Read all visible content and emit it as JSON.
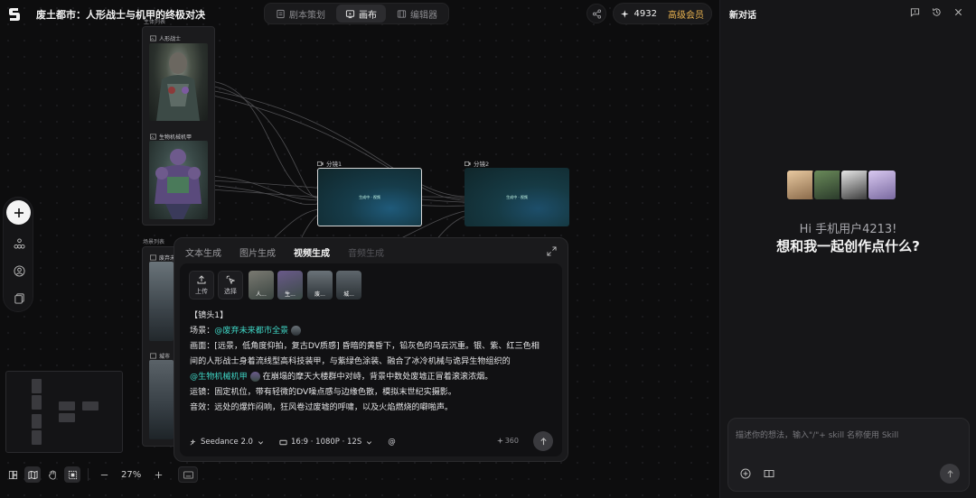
{
  "header": {
    "project_title": "废土都市：人形战士与机甲的终极对决",
    "tabs": [
      {
        "label": "剧本策划",
        "icon": "script-icon",
        "active": false
      },
      {
        "label": "画布",
        "icon": "canvas-icon",
        "active": true
      },
      {
        "label": "编辑器",
        "icon": "editor-icon",
        "active": false
      }
    ],
    "credits": "4932",
    "membership": "高级会员"
  },
  "canvas": {
    "character_group": {
      "title": "主体列表",
      "nodes": [
        {
          "label": "人形战士"
        },
        {
          "label": "生物机械机甲"
        }
      ]
    },
    "scene_group": {
      "title": "场景列表",
      "nodes": [
        {
          "label": "废弃未"
        },
        {
          "label": "城市"
        }
      ]
    },
    "shots": [
      {
        "label": "分镜1",
        "inner_text": "生成中 · 视频"
      },
      {
        "label": "分镜2",
        "inner_text": "生成中 · 视频"
      }
    ],
    "zoom": "27%"
  },
  "generator": {
    "tabs": [
      {
        "label": "文本生成",
        "state": "normal"
      },
      {
        "label": "图片生成",
        "state": "normal"
      },
      {
        "label": "视频生成",
        "state": "active"
      },
      {
        "label": "音频生成",
        "state": "disabled"
      }
    ],
    "upload_label": "上传",
    "select_label": "选择",
    "refs": [
      "人...",
      "生...",
      "废...",
      "城..."
    ],
    "prompt": {
      "heading": "【镜头1】",
      "scene_prefix": "场景：",
      "scene_mention": "@废弃未来都市全景",
      "frame_line1": "画面：[远景，低角度仰拍，复古DV质感] 昏暗的黄昏下，铅灰色的乌云沉重。银、紫、红三色相",
      "frame_line2": "间的人形战士身着流线型高科技装甲，与紫绿色涂装、融合了冰冷机械与诡异生物组织的",
      "mech_mention": "@生物机械机甲",
      "frame_line3": "在崩塌的摩天大楼群中对峙，背景中数处废墟正冒着滚滚浓烟。",
      "camera_line": "运镜：固定机位，带有轻微的DV噪点感与边缘色散，模拟末世纪实摄影。",
      "sound_line": "音效：远处的爆炸闷响，狂风卷过废墟的呼啸，以及火焰燃烧的噼啪声。"
    },
    "model": "Seedance 2.0",
    "spec": "16:9 · 1080P · 12S",
    "at_symbol": "@",
    "cost": "360"
  },
  "chat": {
    "title": "新对话",
    "greeting": "Hi 手机用户4213!",
    "question": "想和我一起创作点什么?",
    "placeholder": "描述你的想法，输入\"/\"+ skill 名称使用 Skill"
  },
  "colors": {
    "accent_mention": "#3fd6c6",
    "vip_gold": "#e9b24f"
  }
}
